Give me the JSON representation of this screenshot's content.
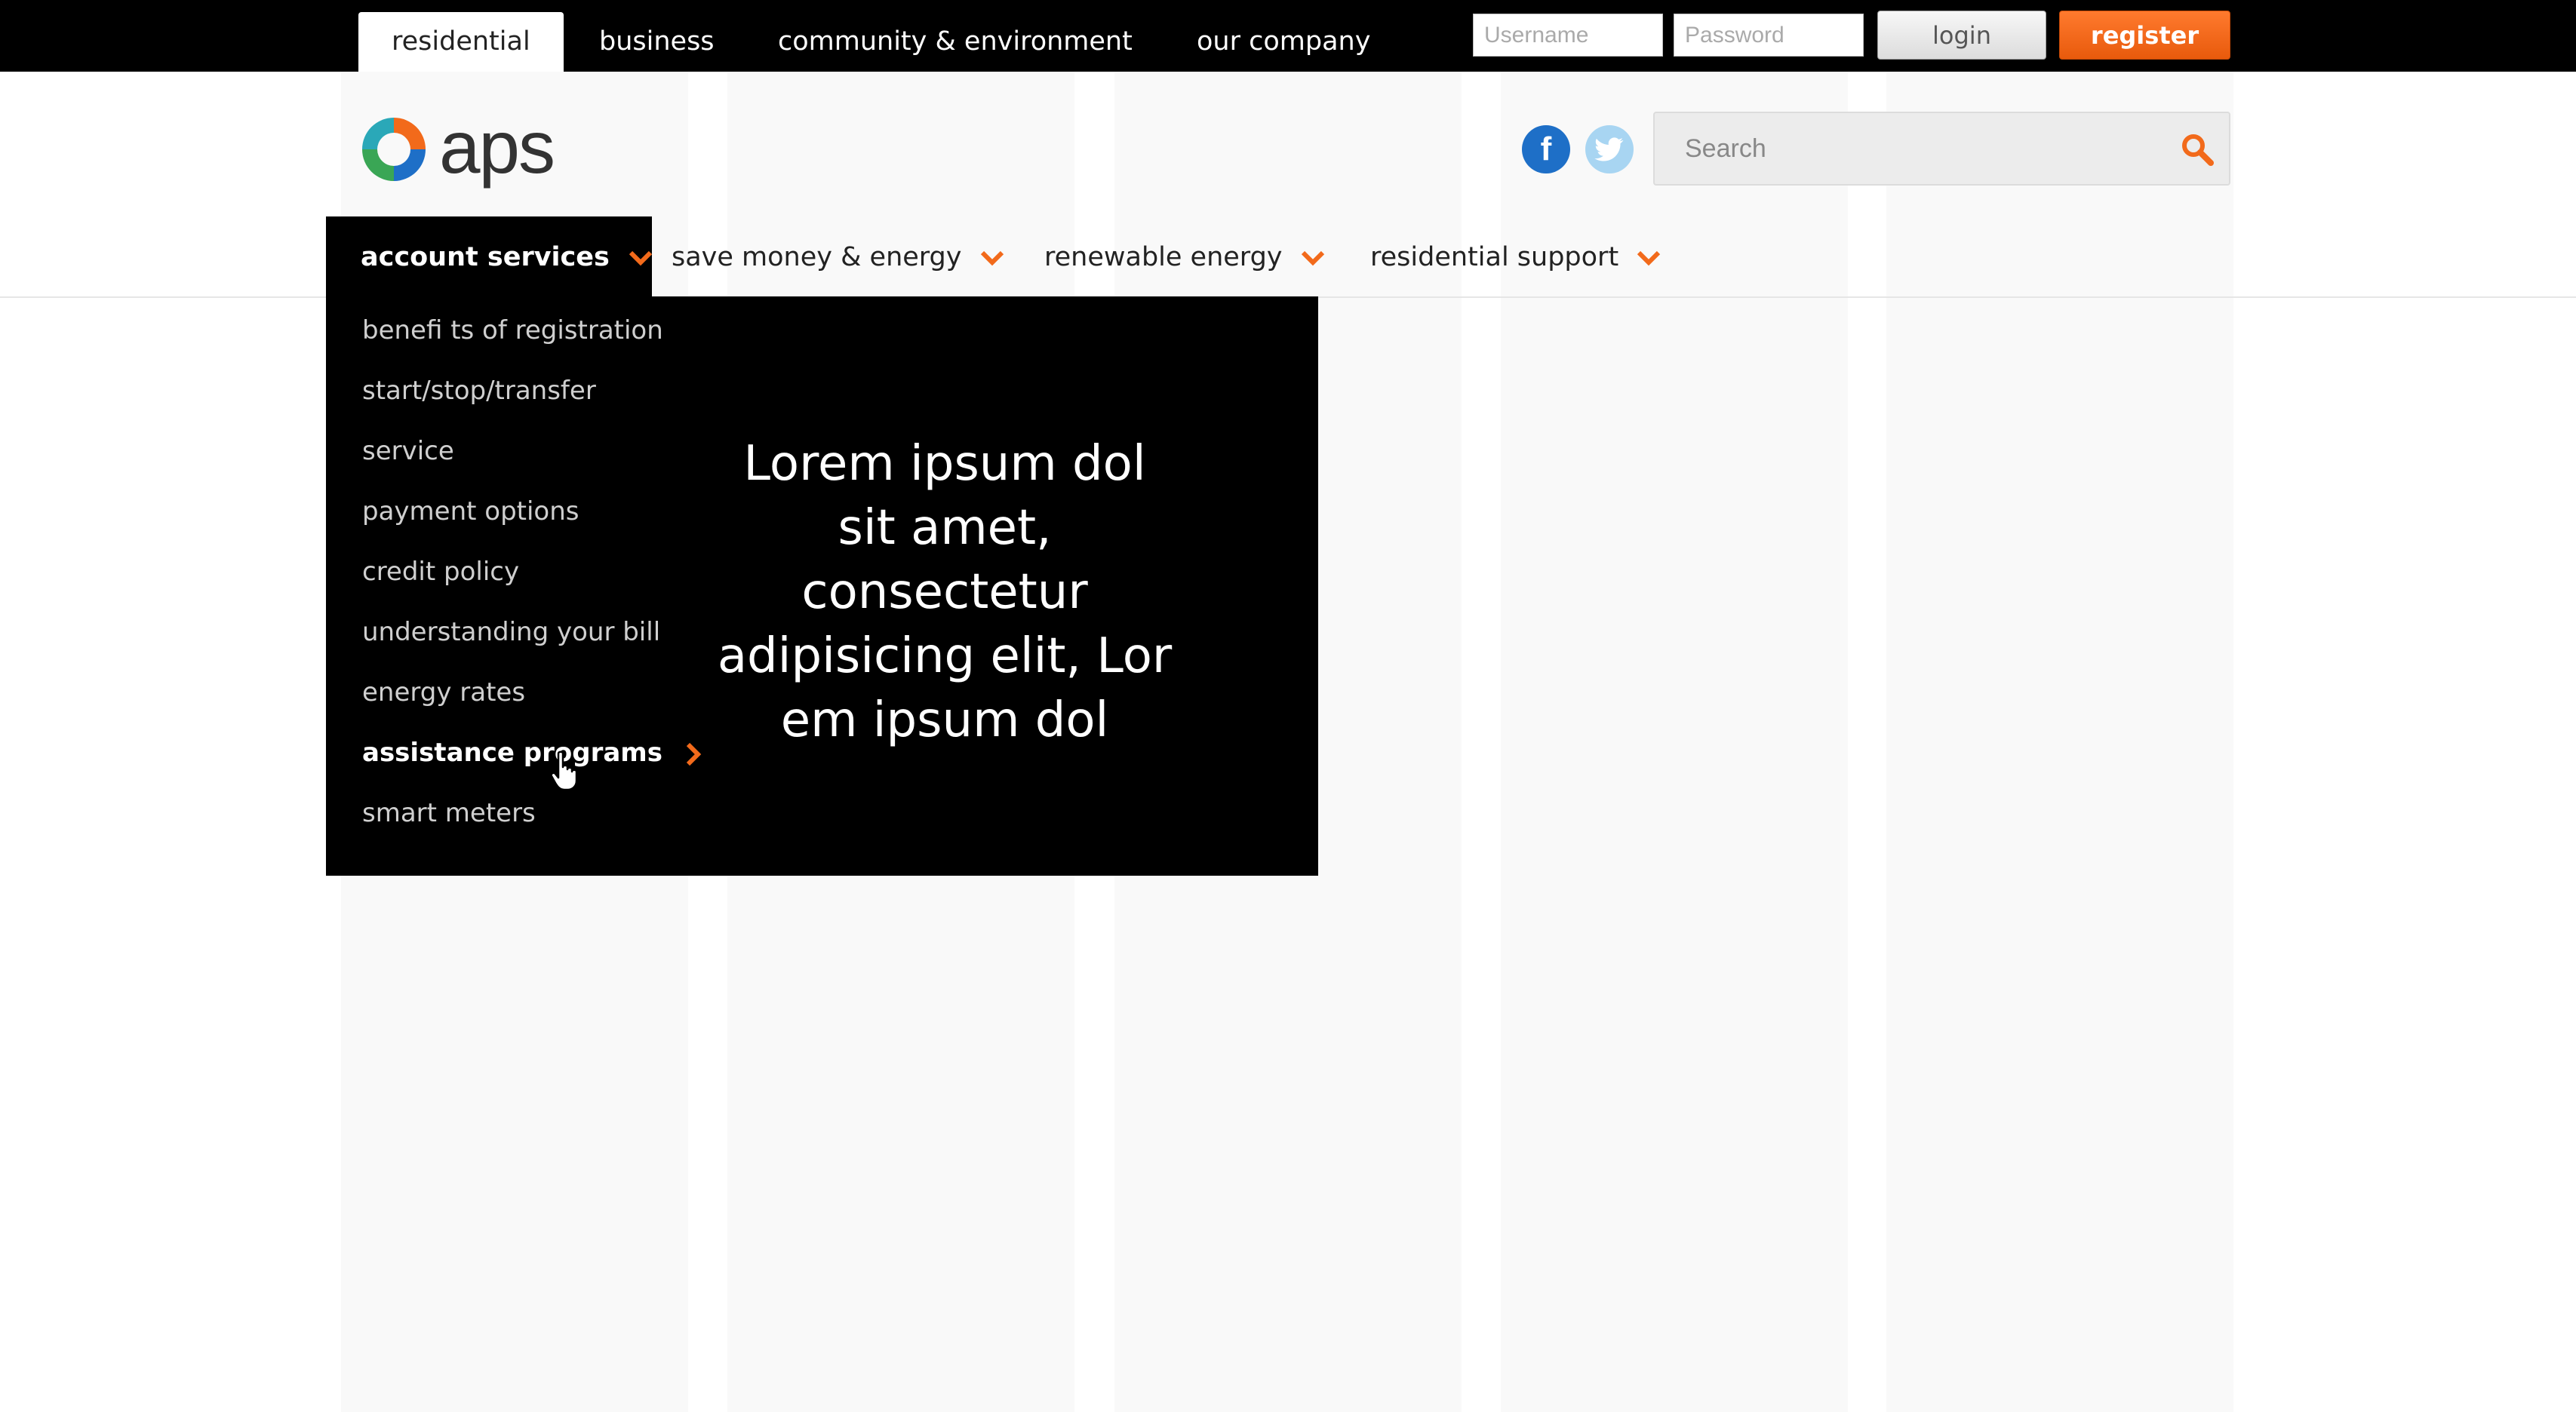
{
  "top_nav": {
    "tabs": [
      {
        "label": "residential",
        "active": true
      },
      {
        "label": "business",
        "active": false
      },
      {
        "label": "community & environment",
        "active": false
      },
      {
        "label": "our company",
        "active": false
      }
    ],
    "username_placeholder": "Username",
    "password_placeholder": "Password",
    "login_label": "login",
    "register_label": "register"
  },
  "header": {
    "logo_text": "aps",
    "social": {
      "facebook_glyph": "f",
      "twitter_glyph": "t"
    },
    "search_placeholder": "Search"
  },
  "main_nav": {
    "items": [
      {
        "label": "account services",
        "active": true
      },
      {
        "label": "save money & energy",
        "active": false
      },
      {
        "label": "renewable energy",
        "active": false
      },
      {
        "label": "residential support",
        "active": false
      }
    ]
  },
  "dropdown": {
    "items": [
      {
        "label": "benefi ts of registration"
      },
      {
        "label": "start/stop/transfer"
      },
      {
        "label": "service"
      },
      {
        "label": "payment options"
      },
      {
        "label": "credit policy"
      },
      {
        "label": "understanding your bill"
      },
      {
        "label": "energy rates"
      },
      {
        "label": "assistance programs",
        "active": true
      },
      {
        "label": "smart meters"
      }
    ],
    "promo_lines": [
      "Lorem ipsum dol",
      "sit amet, consectetur",
      "adipisicing elit, Lor",
      "em ipsum dol"
    ]
  },
  "colors": {
    "accent_orange": "#f26a1b",
    "topbar_bg": "#000000",
    "facebook_blue": "#1e6fc7",
    "twitter_blue": "#a8d5f2"
  },
  "icons": [
    "search-icon",
    "facebook-icon",
    "twitter-icon",
    "chevron-down-icon",
    "chevron-right-icon",
    "hand-cursor-icon"
  ]
}
